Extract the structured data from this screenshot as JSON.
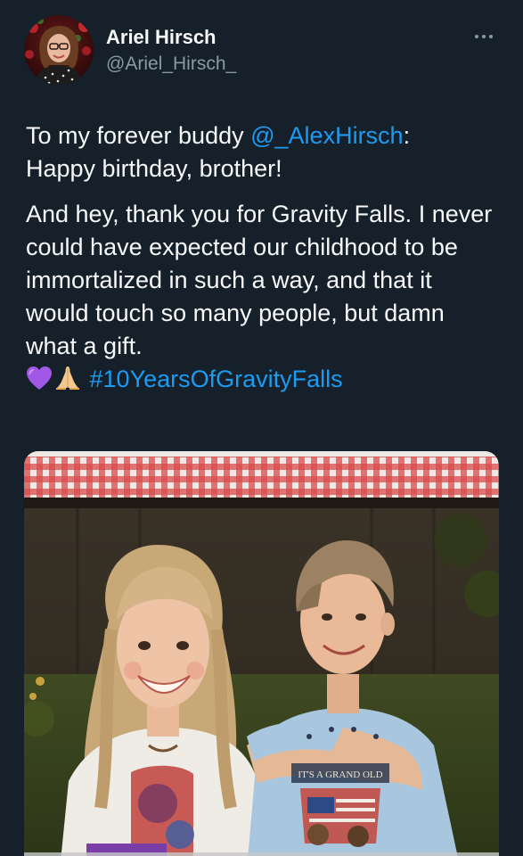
{
  "author": {
    "name": "Ariel Hirsch",
    "handle": "@Ariel_Hirsch_"
  },
  "menu": {
    "icon": "more-horizontal-icon"
  },
  "tweet": {
    "line1_prefix": "To my forever buddy ",
    "mention": "@_AlexHirsch",
    "line1_suffix": ":",
    "line2": "Happy birthday, brother!",
    "paragraph2": "And hey, thank you for Gravity Falls. I never could have expected our childhood to be immortalized in such a way, and that it would touch so many people, but damn what a gift.",
    "emojis": [
      "purple-heart-icon",
      "folded-hands-icon"
    ],
    "hashtag": "#10YearsOfGravityFalls"
  },
  "media": {
    "printed_text": "IT'S A GRAND OLD"
  },
  "colors": {
    "background": "#15202b",
    "text": "#f7f9f9",
    "secondary": "#8b98a5",
    "link": "#1d9bf0"
  }
}
